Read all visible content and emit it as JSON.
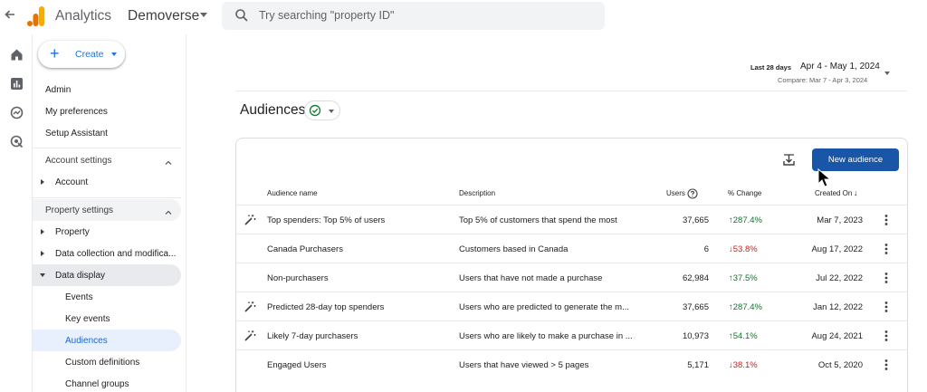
{
  "topbar": {
    "app_name": "Analytics",
    "account": "Demoverse",
    "search_placeholder": "Try searching \"property ID\""
  },
  "sidebar": {
    "create_label": "Create",
    "links": [
      "Admin",
      "My preferences",
      "Setup Assistant"
    ],
    "account_settings": {
      "label": "Account settings",
      "items": [
        "Account"
      ]
    },
    "property_settings": {
      "label": "Property settings",
      "items": [
        "Property",
        "Data collection and modifica...",
        "Data display"
      ],
      "data_display_children": [
        "Events",
        "Key events",
        "Audiences",
        "Custom definitions",
        "Channel groups"
      ]
    }
  },
  "date_range": {
    "label": "Last 28 days",
    "range": "Apr 4 - May 1, 2024",
    "compare": "Compare: Mar 7 - Apr 3, 2024"
  },
  "page": {
    "title": "Audiences"
  },
  "table": {
    "new_audience_label": "New audience",
    "columns": {
      "name": "Audience name",
      "description": "Description",
      "users": "Users",
      "change": "% Change",
      "created": "Created On"
    },
    "rows": [
      {
        "name": "Top spenders: Top 5% of users",
        "description": "Top 5% of customers that spend the most",
        "users": "37,665",
        "change": "287.4%",
        "direction": "up",
        "created": "Mar 7, 2023",
        "predictive": true
      },
      {
        "name": "Canada Purchasers",
        "description": "Customers based in Canada",
        "users": "6",
        "change": "53.8%",
        "direction": "down",
        "created": "Aug 17, 2022",
        "predictive": false
      },
      {
        "name": "Non-purchasers",
        "description": "Users that have not made a purchase",
        "users": "62,984",
        "change": "37.5%",
        "direction": "up",
        "created": "Jul 22, 2022",
        "predictive": false
      },
      {
        "name": "Predicted 28-day top spenders",
        "description": "Users who are predicted to generate the m...",
        "users": "37,665",
        "change": "287.4%",
        "direction": "up",
        "created": "Jan 12, 2022",
        "predictive": true
      },
      {
        "name": "Likely 7-day purchasers",
        "description": "Users who are likely to make a purchase in ...",
        "users": "10,973",
        "change": "54.1%",
        "direction": "up",
        "created": "Aug 24, 2021",
        "predictive": true
      },
      {
        "name": "Engaged Users",
        "description": "Users that have viewed > 5 pages",
        "users": "5,171",
        "change": "38.1%",
        "direction": "down",
        "created": "Oct 5, 2020",
        "predictive": false
      }
    ]
  }
}
